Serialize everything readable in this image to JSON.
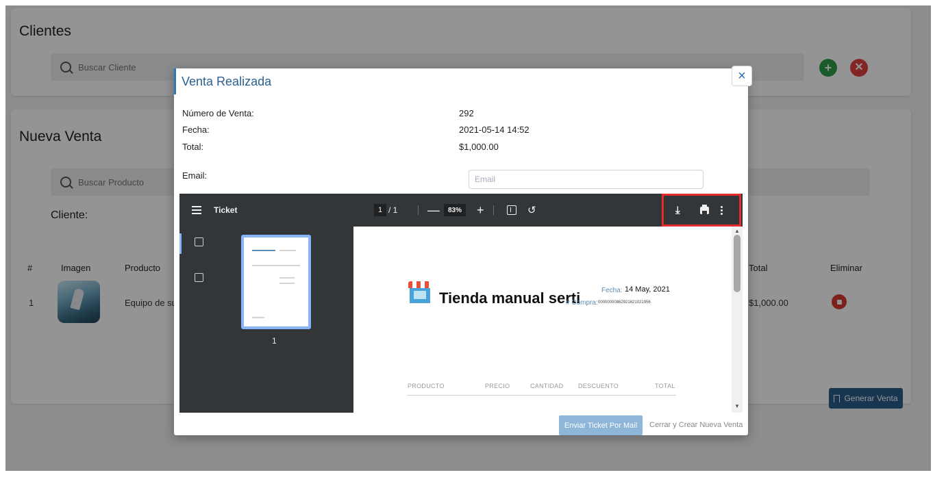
{
  "clientes_card": {
    "title": "Clientes",
    "search_placeholder": "Buscar Cliente",
    "add_icon": "plus-circle-icon",
    "clear_icon": "x-circle-icon",
    "colors": {
      "add": "#2e9d47",
      "clear": "#e0403e"
    }
  },
  "venta_card": {
    "title": "Nueva Venta",
    "search_placeholder": "Buscar Producto",
    "cliente_label": "Cliente:",
    "table": {
      "headers": [
        "#",
        "Imagen",
        "Producto",
        "Total",
        "Eliminar"
      ],
      "rows": [
        {
          "num": "1",
          "producto": "Equipo de su",
          "total": "$1,000.00"
        }
      ]
    },
    "generate_button": "Generar Venta"
  },
  "modal": {
    "title": "Venta Realizada",
    "close_symbol": "×",
    "fields": [
      {
        "label": "Número de Venta:",
        "value": "292"
      },
      {
        "label": "Fecha:",
        "value": "2021-05-14 14:52"
      },
      {
        "label": "Total:",
        "value": "$1,000.00"
      }
    ],
    "email_label": "Email:",
    "email_placeholder": "Email",
    "send_button": "Enviar Ticket Por Mail",
    "new_sale_link": "Cerrar y Crear Nueva Venta",
    "accent_color": "#2b78b8",
    "highlight_color": "#e32b2b"
  },
  "pdf_viewer": {
    "doc_title": "Ticket",
    "page_current": "1",
    "page_total": "/ 1",
    "zoom": "83%",
    "zoom_out": "—",
    "zoom_in": "+",
    "thumbnail_page": "1",
    "toolbar_icons": [
      "menu-icon",
      "fit-page-icon",
      "rotate-icon",
      "download-icon",
      "print-icon",
      "more-icon"
    ],
    "document": {
      "store_name": "Tienda manual serti",
      "fecha_label": "Fecha:",
      "fecha_value": "14 May, 2021",
      "compra_label": "# Compra:",
      "compra_value": "00000000862921621021956",
      "columns": [
        "PRODUCTO",
        "PRECIO",
        "CANTIDAD",
        "DESCUENTO",
        "TOTAL"
      ]
    }
  }
}
